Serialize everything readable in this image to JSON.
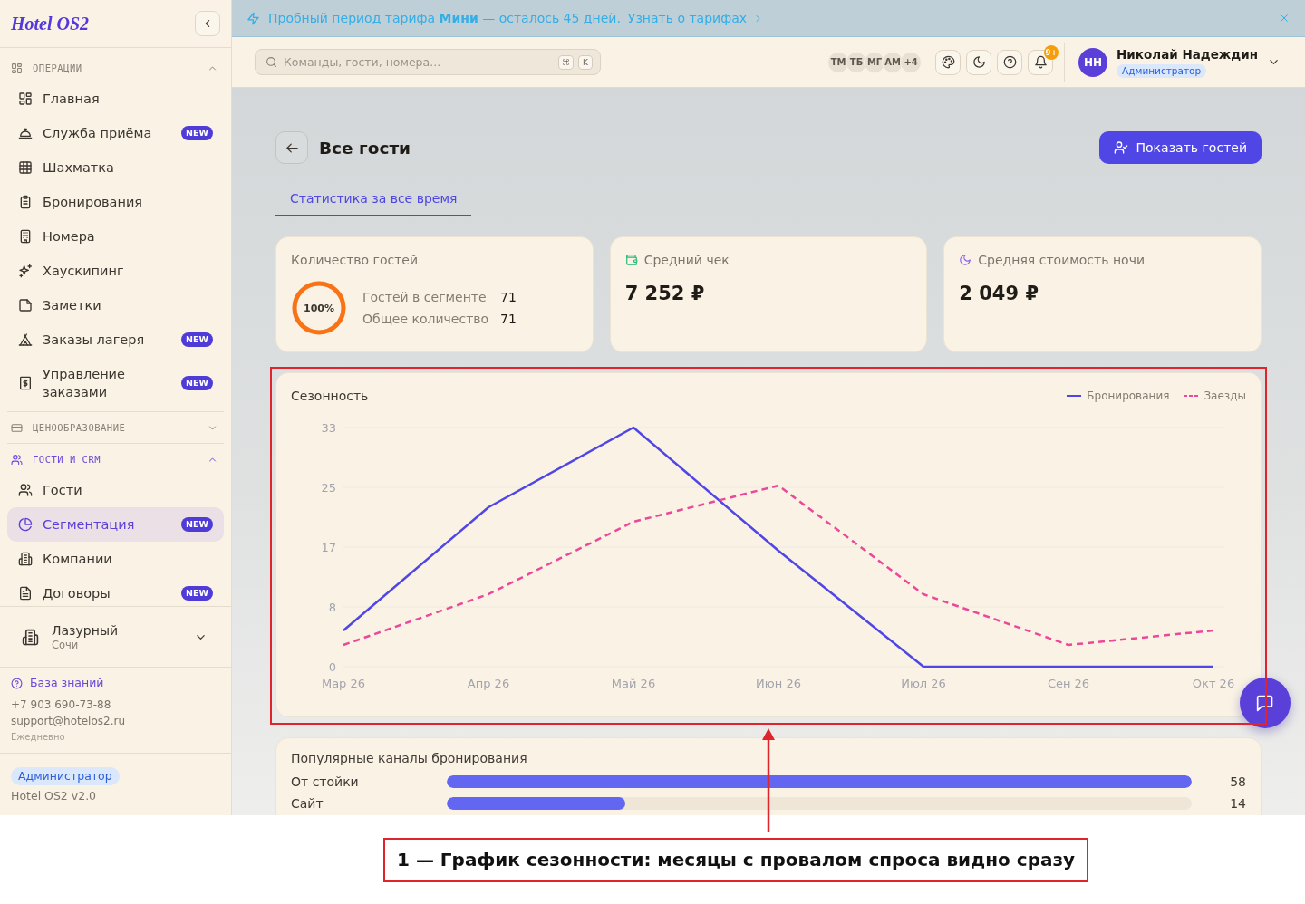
{
  "sidebar": {
    "logo": "Hotel OS2",
    "sections": [
      {
        "title": "ОПЕРАЦИИ",
        "expanded": true,
        "active": false,
        "items": [
          {
            "label": "Главная",
            "selected": false
          },
          {
            "label": "Служба приёма",
            "badge": "NEW",
            "selected": false
          },
          {
            "label": "Шахматка",
            "selected": false
          },
          {
            "label": "Бронирования",
            "selected": false
          },
          {
            "label": "Номера",
            "selected": false
          },
          {
            "label": "Хаускипинг",
            "selected": false
          },
          {
            "label": "Заметки",
            "selected": false
          },
          {
            "label": "Заказы лагеря",
            "badge": "NEW",
            "selected": false
          },
          {
            "label": "Управление заказами",
            "badge": "NEW",
            "selected": false
          }
        ]
      },
      {
        "title": "ЦЕНООБРАЗОВАНИЕ",
        "expanded": false,
        "active": false
      },
      {
        "title": "ГОСТИ И CRM",
        "expanded": true,
        "active": true,
        "items": [
          {
            "label": "Гости",
            "selected": false
          },
          {
            "label": "Сегментация",
            "badge": "NEW",
            "selected": true
          },
          {
            "label": "Компании",
            "selected": false
          },
          {
            "label": "Договоры",
            "badge": "NEW",
            "selected": false
          }
        ]
      }
    ],
    "property": {
      "name": "Лазурный",
      "city": "Сочи"
    },
    "support": {
      "link": "База знаний",
      "phone": "+7 903 690-73-88",
      "email": "support@hotelos2.ru",
      "hours": "Ежедневно"
    },
    "footer": {
      "role": "Администратор",
      "version": "Hotel OS2 v2.0"
    }
  },
  "banner": {
    "text": "Пробный период тарифа **Мини** — осталось 45 дней.",
    "link": "Узнать о тарифах"
  },
  "topbar": {
    "search": {
      "placeholder": "Команды, гости, номера...",
      "shortcut": [
        "⌘",
        "K"
      ]
    },
    "presence": [
      {
        "initials": "ТМ"
      },
      {
        "initials": "ТБ"
      },
      {
        "initials": "МГ"
      },
      {
        "initials": "АМ"
      }
    ],
    "presence_more": "+4",
    "notifications_badge": "9+",
    "user": {
      "initials": "НН",
      "name": "Николай Надеждин",
      "role": "Администратор"
    }
  },
  "page": {
    "title": "Все гости",
    "action": "Показать гостей",
    "tabs": [
      {
        "label": "Статистика за все время",
        "selected": true
      }
    ]
  },
  "stats": [
    {
      "kind": "ring",
      "title": "Количество гостей",
      "ring_label": "100%",
      "level": 1,
      "rows": [
        {
          "label": "Гостей в сегменте",
          "value": "71"
        },
        {
          "label": "Общее количество",
          "value": "71"
        }
      ]
    },
    {
      "kind": "amount",
      "title": "Средний чек",
      "value": "7 252 ₽"
    },
    {
      "kind": "amount",
      "title": "Средняя стоимость ночи",
      "value": "2 049 ₽"
    }
  ],
  "seasonality": {
    "chart_data": {
      "type": "line",
      "title": "Сезонность",
      "categories": [
        "Мар 26",
        "Апр 26",
        "Май 26",
        "Июн 26",
        "Июл 26",
        "Сен 26",
        "Окт 26"
      ],
      "series": [
        {
          "name": "Бронирования",
          "color": "#4f46e5",
          "line_style": "solid",
          "values": [
            5,
            22,
            33,
            16,
            0,
            0,
            0
          ]
        },
        {
          "name": "Заезды",
          "color": "#ec4899",
          "line_style": "dashed",
          "values": [
            3,
            10,
            20,
            25,
            10,
            3,
            5
          ]
        }
      ],
      "ylim": [
        0,
        33
      ],
      "yticks": [
        0,
        {
          "value": 8.25,
          "label": "8"
        },
        {
          "value": 16.5,
          "label": "17"
        },
        {
          "value": 24.75,
          "label": "25"
        },
        33
      ],
      "grid": true
    }
  },
  "channels": {
    "title": "Популярные каналы бронирования",
    "rows": [
      {
        "label": "От стойки",
        "value": "58",
        "level": 1
      },
      {
        "label": "Сайт",
        "value": "14",
        "level": 0.24
      }
    ]
  },
  "annotation": {
    "caption": "1 — График сезонности: месяцы с провалом спроса видно сразу"
  }
}
